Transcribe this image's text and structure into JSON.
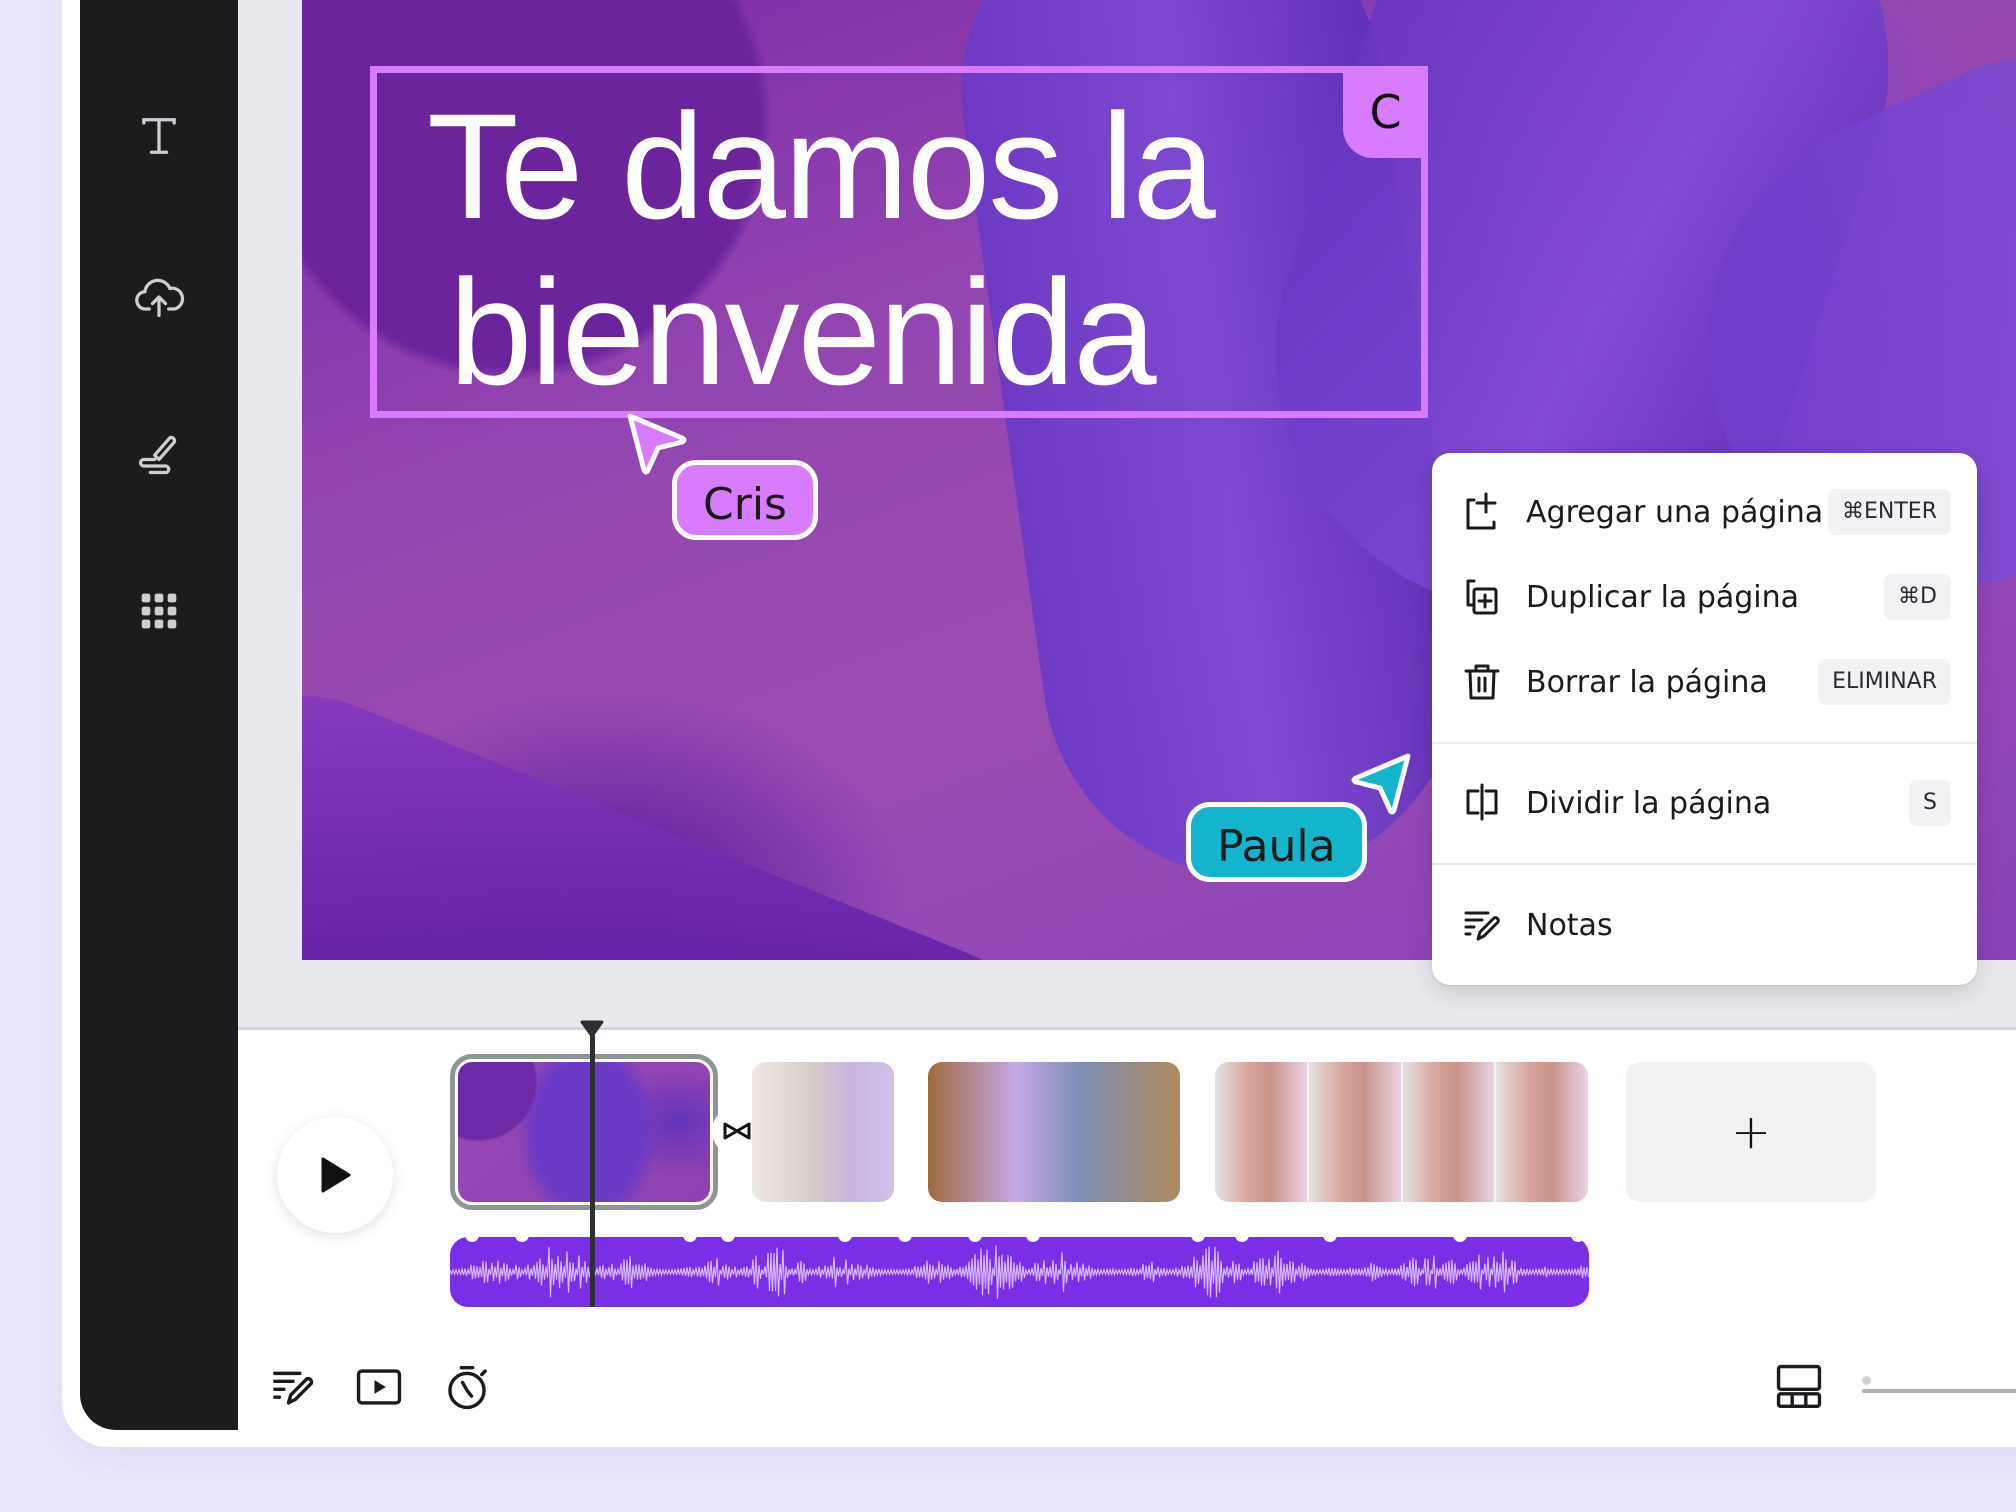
{
  "sidebar": {
    "items": [
      {
        "name": "text",
        "icon": "text-icon"
      },
      {
        "name": "uploads",
        "icon": "cloud-upload-icon"
      },
      {
        "name": "draw",
        "icon": "draw-icon"
      },
      {
        "name": "apps",
        "icon": "apps-grid-icon"
      }
    ]
  },
  "canvas": {
    "title_line1": "Te damos la",
    "title_line2": "bienvenida",
    "selection_badge": "C"
  },
  "collaborators": [
    {
      "name": "Cris",
      "color": "#d97bff"
    },
    {
      "name": "Paula",
      "color": "#12b5cb"
    }
  ],
  "context_menu": {
    "items": [
      {
        "label": "Agregar una página",
        "shortcut": "⌘ENTER",
        "icon": "add-page-icon"
      },
      {
        "label": "Duplicar la página",
        "shortcut": "⌘D",
        "icon": "duplicate-page-icon"
      },
      {
        "label": "Borrar la página",
        "shortcut": "ELIMINAR",
        "icon": "trash-icon"
      },
      {
        "label": "Dividir la página",
        "shortcut": "S",
        "icon": "split-page-icon"
      },
      {
        "label": "Notas",
        "shortcut": "",
        "icon": "notes-icon"
      }
    ]
  },
  "timeline": {
    "add_clip_label": "+",
    "clips": [
      {
        "name": "clip-purple-abstract",
        "selected": true
      },
      {
        "name": "clip-woman-laptop",
        "selected": false
      },
      {
        "name": "clip-two-women-tablet",
        "selected": false
      },
      {
        "name": "clip-woman-pink-shirt",
        "selected": false
      }
    ]
  },
  "bottom_toolbar": {
    "tools": [
      "notes-icon",
      "present-icon",
      "timer-icon"
    ],
    "view": "grid-view-icon"
  },
  "colors": {
    "accent_purple": "#7a2ee6",
    "selection": "#d97bff",
    "collab_teal": "#12b5cb",
    "sidebar_bg": "#1b1c1e"
  }
}
